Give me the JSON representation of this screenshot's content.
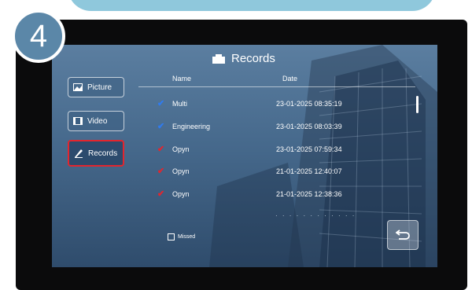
{
  "step_number": "4",
  "screen": {
    "title": "Records",
    "title_icon": "folder-icon",
    "columns": {
      "name": "Name",
      "date": "Date"
    },
    "sidebar": [
      {
        "label": "Picture",
        "icon": "picture-icon"
      },
      {
        "label": "Video",
        "icon": "video-icon"
      },
      {
        "label": "Records",
        "icon": "records-icon",
        "selected": true
      }
    ],
    "records": [
      {
        "name": "Multi",
        "date": "23-01-2025 08:35:19",
        "status": "answered",
        "check_color": "#2f7bf0"
      },
      {
        "name": "Engineering",
        "date": "23-01-2025 08:03:39",
        "status": "answered",
        "check_color": "#2f7bf0"
      },
      {
        "name": "Opyn",
        "date": "23-01-2025 07:59:34",
        "status": "missed",
        "check_color": "#e3252e"
      },
      {
        "name": "Opyn",
        "date": "21-01-2025 12:40:07",
        "status": "missed",
        "check_color": "#e3252e"
      },
      {
        "name": "Opyn",
        "date": "21-01-2025 12:38:36",
        "status": "missed",
        "check_color": "#e3252e"
      }
    ],
    "missed_filter_label": "Missed",
    "back_icon": "back-arrow-icon"
  },
  "colors": {
    "highlight_border": "#e3252e",
    "badge": "#5b87a8",
    "banner": "#8fc8dc"
  }
}
